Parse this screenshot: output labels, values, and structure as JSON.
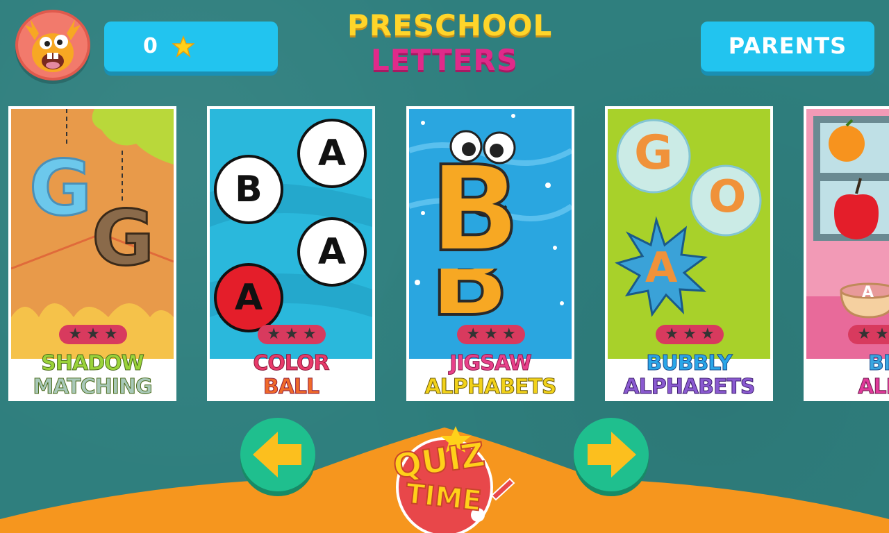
{
  "header": {
    "score": "0",
    "parents_label": "PARENTS",
    "title_line1": "PRESCHOOL",
    "title_line2": "LETTERS"
  },
  "cards": [
    {
      "label_line1": "SHADOW",
      "label_line2": "MATCHING",
      "letter": "G",
      "rating_stars": 3
    },
    {
      "label_line1": "COLOR",
      "label_line2": "BALL",
      "balls": [
        "A",
        "B",
        "A",
        "A"
      ],
      "rating_stars": 3
    },
    {
      "label_line1": "JIGSAW",
      "label_line2": "ALPHABETS",
      "letter": "B",
      "rating_stars": 3
    },
    {
      "label_line1": "BUBBLY",
      "label_line2": "ALPHABETS",
      "bubbles": [
        "G",
        "O",
        "A"
      ],
      "rating_stars": 3
    },
    {
      "label_line1": "BIN",
      "label_line2": "ALPH",
      "cup_letter": "A",
      "rating_stars": 3
    }
  ],
  "quiz": {
    "line1": "QUIZ",
    "line2": "TIME"
  },
  "colors": {
    "background": "#2f7f7e",
    "button_blue": "#22c4ef",
    "arrow_green": "#1fbf8e",
    "arrow_yellow": "#fcbf1e",
    "hill_orange": "#f6961e"
  }
}
